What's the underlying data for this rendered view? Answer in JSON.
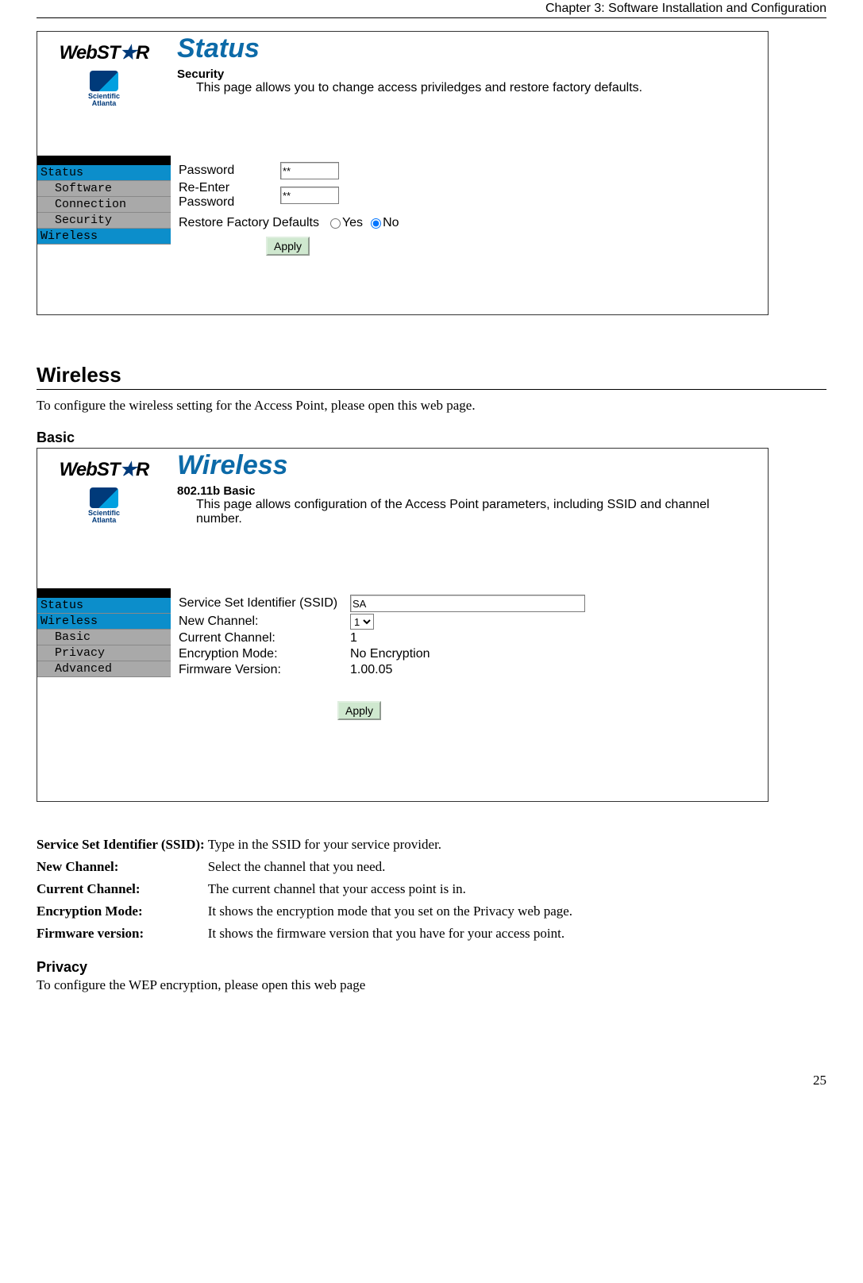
{
  "header": {
    "chapter": "Chapter 3: Software Installation and Configuration"
  },
  "screenshot1": {
    "logo_main": "WebST",
    "logo_suffix": "R",
    "logo_sa1": "Scientific",
    "logo_sa2": "Atlanta",
    "title": "Status",
    "subtitle": "Security",
    "description": "This page allows you to change access priviledges and restore factory defaults.",
    "nav": {
      "head1": "Status",
      "sub1": "Software",
      "sub2": "Connection",
      "sub3": "Security",
      "head2": "Wireless"
    },
    "form": {
      "password_label": "Password",
      "password_value": "**",
      "reenter_label": "Re-Enter Password",
      "reenter_value": "**",
      "restore_label": "Restore Factory Defaults",
      "yes": "Yes",
      "no": "No",
      "apply": "Apply"
    }
  },
  "section_wireless": {
    "heading": "Wireless",
    "intro": "To configure the wireless setting for the Access Point, please open this web page."
  },
  "basic_heading": "Basic",
  "screenshot2": {
    "logo_main": "WebST",
    "logo_suffix": "R",
    "logo_sa1": "Scientific",
    "logo_sa2": "Atlanta",
    "title": "Wireless",
    "subtitle": "802.11b Basic",
    "description": "This page allows configuration of the Access Point parameters, including SSID and channel number.",
    "nav": {
      "head1": "Status",
      "head2": "Wireless",
      "sub1": "Basic",
      "sub2": "Privacy",
      "sub3": "Advanced"
    },
    "form": {
      "ssid_label": "Service Set Identifier (SSID)",
      "ssid_value": "SA",
      "newch_label": "New Channel:",
      "newch_value": "1",
      "curch_label": "Current Channel:",
      "curch_value": "1",
      "enc_label": "Encryption Mode:",
      "enc_value": "No Encryption",
      "fw_label": "Firmware Version:",
      "fw_value": "1.00.05",
      "apply": "Apply"
    }
  },
  "definitions": [
    {
      "term": "Service Set Identifier (SSID):",
      "desc": "Type in the SSID for your service provider."
    },
    {
      "term": "New Channel:",
      "desc": "Select the channel that you need."
    },
    {
      "term": "Current Channel:",
      "desc": "The current channel that your access point is in."
    },
    {
      "term": "Encryption Mode:",
      "desc": "It shows the encryption mode that you set on the Privacy web page."
    },
    {
      "term": "Firmware version:",
      "desc": "It shows the firmware version that you have for your access point."
    }
  ],
  "privacy": {
    "heading": "Privacy",
    "intro": "To configure the WEP encryption, please open this web page"
  },
  "page_number": "25"
}
